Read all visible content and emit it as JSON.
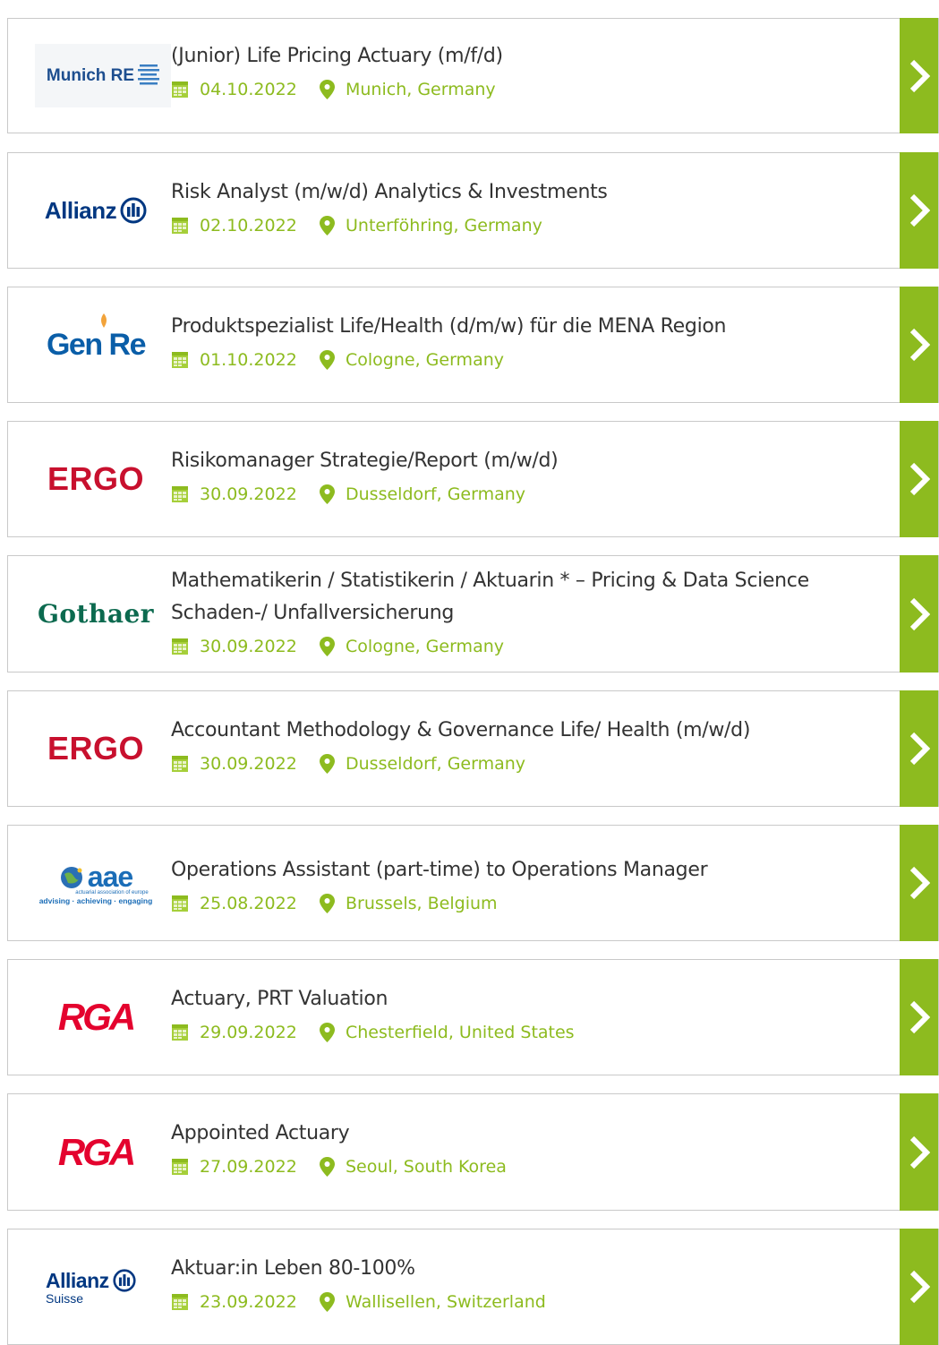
{
  "colors": {
    "accent": "#8dbb1f",
    "border": "#c9c9c9",
    "title": "#333333"
  },
  "jobs": [
    {
      "company": "Munich RE",
      "logo_icon": "munich-re-logo",
      "title": "(Junior) Life Pricing Actuary (m/f/d)",
      "date": "04.10.2022",
      "location": "Munich, Germany"
    },
    {
      "company": "Allianz",
      "logo_icon": "allianz-logo",
      "title": "Risk Analyst (m/w/d) Analytics & Investments",
      "date": "02.10.2022",
      "location": "Unterföhring, Germany"
    },
    {
      "company": "Gen Re",
      "logo_icon": "gen-re-logo",
      "title": "Produktspezialist Life/Health (d/m/w) für die MENA Region",
      "date": "01.10.2022",
      "location": "Cologne, Germany"
    },
    {
      "company": "ERGO",
      "logo_icon": "ergo-logo",
      "title": "Risikomanager Strategie/Report (m/w/d)",
      "date": "30.09.2022",
      "location": "Dusseldorf, Germany"
    },
    {
      "company": "Gothaer",
      "logo_icon": "gothaer-logo",
      "title": "Mathematikerin / Statistikerin / Aktuarin * – Pricing & Data Science",
      "title_line2": "Schaden-/ Unfallversicherung",
      "date": "30.09.2022",
      "location": "Cologne, Germany"
    },
    {
      "company": "ERGO",
      "logo_icon": "ergo-logo",
      "title": "Accountant Methodology & Governance Life/ Health (m/w/d)",
      "date": "30.09.2022",
      "location": "Dusseldorf, Germany"
    },
    {
      "company": "aae",
      "logo_icon": "aae-logo",
      "logo_sub": "actuarial association of europe",
      "logo_tagline": "advising · achieving · engaging",
      "title": "Operations Assistant (part-time) to Operations Manager",
      "date": "25.08.2022",
      "location": "Brussels, Belgium"
    },
    {
      "company": "RGA",
      "logo_icon": "rga-logo",
      "title": "Actuary, PRT Valuation",
      "date": "29.09.2022",
      "location": "Chesterfield, United States"
    },
    {
      "company": "RGA",
      "logo_icon": "rga-logo",
      "title": "Appointed Actuary",
      "date": "27.09.2022",
      "location": "Seoul, South Korea"
    },
    {
      "company": "Allianz",
      "logo_sub": "Suisse",
      "logo_icon": "allianz-suisse-logo",
      "title": "Aktuar:in Leben 80-100%",
      "date": "23.09.2022",
      "location": "Wallisellen, Switzerland"
    }
  ]
}
